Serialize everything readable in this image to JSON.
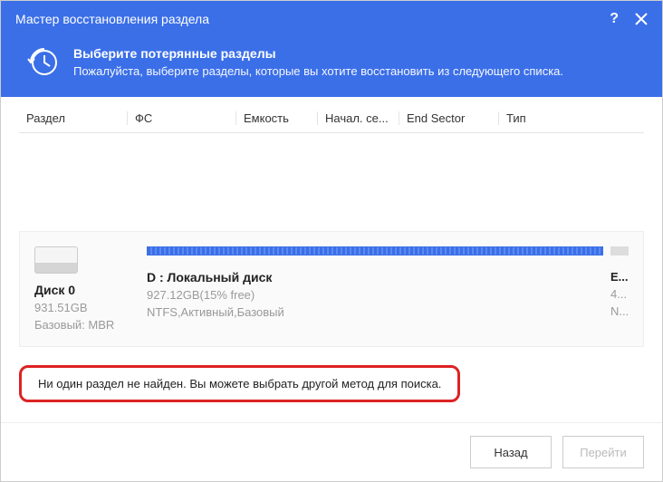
{
  "titlebar": {
    "title": "Мастер восстановления раздела"
  },
  "banner": {
    "heading": "Выберите потерянные разделы",
    "sub": "Пожалуйста, выберите разделы, которые вы хотите восстановить из следующего списка."
  },
  "columns": {
    "part": "Раздел",
    "fs": "ФС",
    "cap": "Емкость",
    "start": "Начал. се...",
    "end": "End Sector",
    "type": "Тип"
  },
  "disk": {
    "name": "Диск 0",
    "size": "931.51GB",
    "type": "Базовый: MBR"
  },
  "partition": {
    "name": "D : Локальный диск",
    "size": "927.12GB(15% free)",
    "attrs": "NTFS,Активный,Базовый"
  },
  "tail": {
    "l1": "E...",
    "l2": "4...",
    "l3": "N..."
  },
  "status": "Ни один раздел не найден. Вы можете выбрать другой метод для поиска.",
  "footer": {
    "back": "Назад",
    "next": "Перейти"
  }
}
